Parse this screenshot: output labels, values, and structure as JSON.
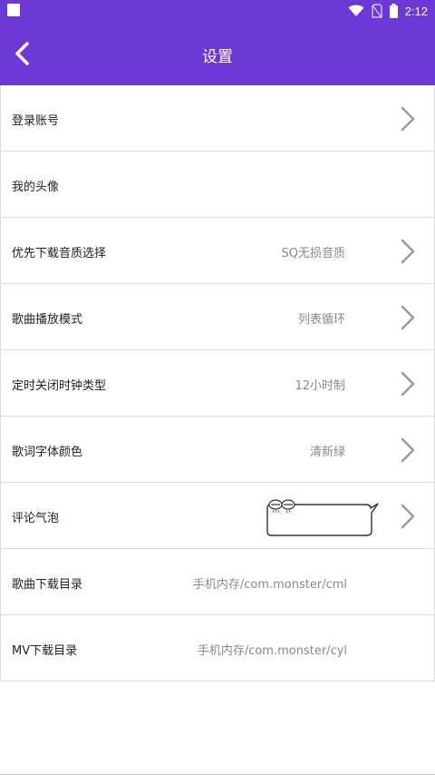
{
  "status_bar": {
    "time": "2:12",
    "icons": [
      "notification-square-icon",
      "wifi-icon",
      "no-sim-icon",
      "battery-icon"
    ]
  },
  "header": {
    "title": "设置",
    "back_icon": "chevron-left-icon"
  },
  "theme": {
    "accent": "#6c38d6",
    "divider": "#dddddd",
    "label_color": "#222222",
    "value_color": "#888888"
  },
  "settings": [
    {
      "label": "登录账号",
      "value": "",
      "chevron": true
    },
    {
      "label": "我的头像",
      "value": "",
      "chevron": false
    },
    {
      "label": "优先下载音质选择",
      "value": "SQ无损音质",
      "chevron": true
    },
    {
      "label": "歌曲播放模式",
      "value": "列表循环",
      "chevron": true
    },
    {
      "label": "定时关闭时钟类型",
      "value": "12小时制",
      "chevron": true
    },
    {
      "label": "歌词字体颜色",
      "value": "清新绿",
      "chevron": true
    },
    {
      "label": "评论气泡",
      "value": "",
      "chevron": true,
      "preview": "comment-bubble-preview"
    },
    {
      "label": "歌曲下载目录",
      "value": "手机内存/com.monster/cml",
      "chevron": false
    },
    {
      "label": "MV下载目录",
      "value": "手机内存/com.monster/cyl",
      "chevron": false
    }
  ]
}
